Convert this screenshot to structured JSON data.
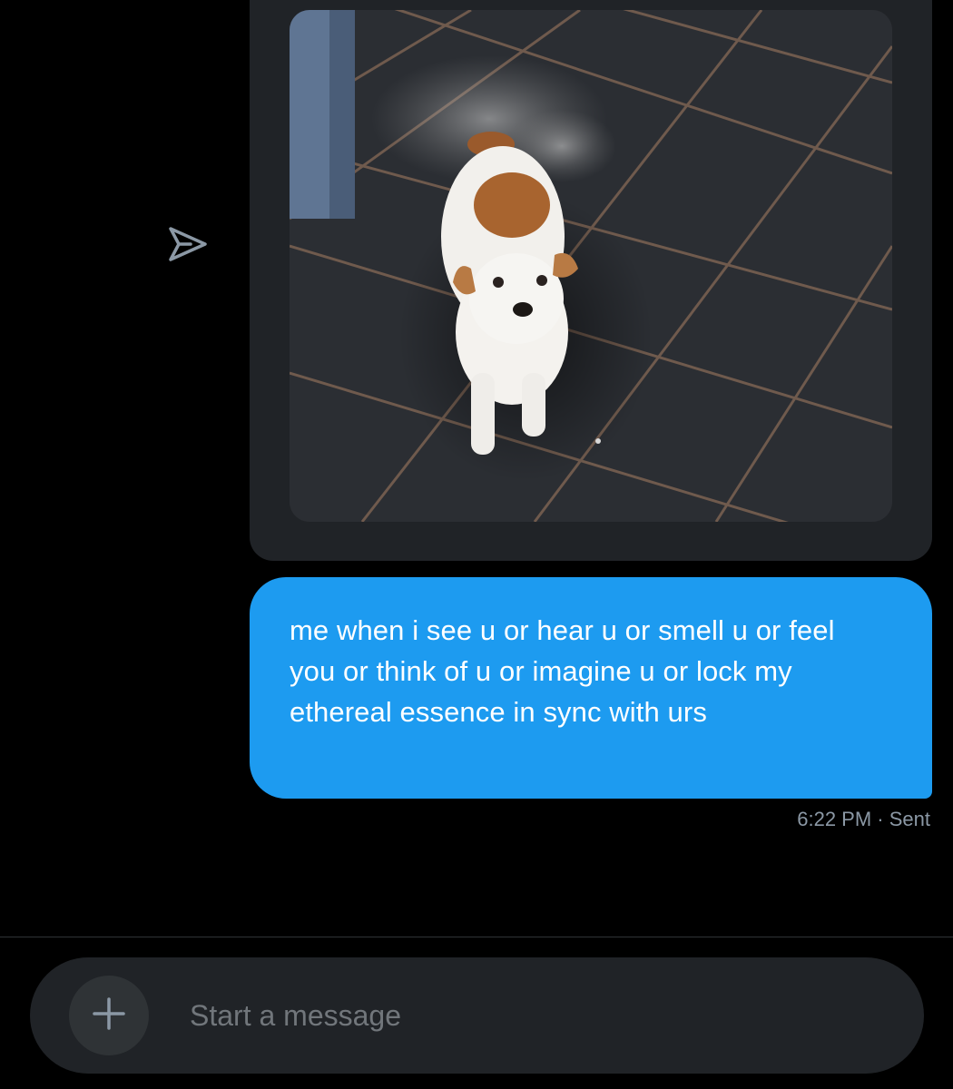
{
  "conversation": {
    "share_icon": "share-arrow-icon",
    "media": {
      "icon": "photo-attachment"
    },
    "messages": [
      {
        "text": "me when i see u or hear u or smell u or feel you or think of u or imagine u or lock my ethereal essence in sync with urs",
        "time": "6:22 PM",
        "status": "· Sent"
      }
    ]
  },
  "composer": {
    "placeholder": "Start a message",
    "add_icon": "plus-icon",
    "voice_icon": "voice-wave-icon"
  },
  "colors": {
    "background": "#000000",
    "bubble_sent": "#1d9bf0",
    "card": "#202327",
    "meta_text": "#8b98a5",
    "voice_accent": "#7856ff"
  }
}
